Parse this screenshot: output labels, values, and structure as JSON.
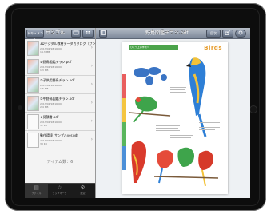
{
  "sidebar": {
    "back_label": "ドキュメント",
    "title": "サンプル",
    "items": [
      {
        "name": "3Dデジタル教材データカタログ（サンプル）.pdf",
        "meta": "2013/02/18 16:00\n14.3 MB"
      },
      {
        "name": "①野鳥図鑑チラシ.pdf",
        "meta": "2013/02/18 16:00\n1.3 MB"
      },
      {
        "name": "②子供用野鳥チラシ.pdf",
        "meta": "2013/02/18 16:00\n1.6 MB"
      },
      {
        "name": "③中野鳥図鑑チラシ.pdf",
        "meta": "2013/02/18 16:00\n2.4 MB"
      },
      {
        "name": "★見積書.pdf",
        "meta": "2013/02/18 16:00\n52 KB"
      },
      {
        "name": "動作環境_サンプルver.pdf",
        "meta": "2013/02/18 16:00\n38 KB"
      }
    ],
    "count_label": "アイテム数：6"
  },
  "tabs": [
    {
      "label": "ファイル",
      "icon": "folder-icon"
    },
    {
      "label": "ブックマーク",
      "icon": "bookmark-icon"
    },
    {
      "label": "設定",
      "icon": "gear-icon"
    }
  ],
  "viewer": {
    "title": "野鳥図鑑チラシ.pdf",
    "list_button": "目次",
    "doc": {
      "banner": "ひとつ上の学習へ",
      "logo": "Birds"
    }
  }
}
